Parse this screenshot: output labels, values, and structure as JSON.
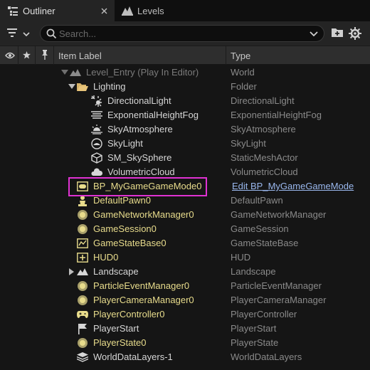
{
  "tabs": [
    {
      "label": "Outliner",
      "icon": "outliner-icon",
      "active": true
    },
    {
      "label": "Levels",
      "icon": "levels-icon",
      "active": false
    }
  ],
  "search": {
    "placeholder": "Search..."
  },
  "columns": {
    "item_label": "Item Label",
    "type": "Type"
  },
  "rows": [
    {
      "label": "Level_Entry (Play In Editor)",
      "type": "World",
      "icon": "world-icon",
      "style": "dim",
      "indent": 0,
      "expander": "expanded-dim"
    },
    {
      "label": "Lighting",
      "type": "Folder",
      "icon": "folder-open-icon",
      "style": "white",
      "indent": 1,
      "expander": "expanded"
    },
    {
      "label": "DirectionalLight",
      "type": "DirectionalLight",
      "icon": "directional-light-icon",
      "style": "white",
      "indent": 2
    },
    {
      "label": "ExponentialHeightFog",
      "type": "ExponentialHeightFog",
      "icon": "height-fog-icon",
      "style": "white",
      "indent": 2
    },
    {
      "label": "SkyAtmosphere",
      "type": "SkyAtmosphere",
      "icon": "sky-atmosphere-icon",
      "style": "white",
      "indent": 2
    },
    {
      "label": "SkyLight",
      "type": "SkyLight",
      "icon": "sky-light-icon",
      "style": "white",
      "indent": 2
    },
    {
      "label": "SM_SkySphere",
      "type": "StaticMeshActor",
      "icon": "static-mesh-icon",
      "style": "white",
      "indent": 2
    },
    {
      "label": "VolumetricCloud",
      "type": "VolumetricCloud",
      "icon": "volumetric-cloud-icon",
      "style": "white",
      "indent": 2
    },
    {
      "label": "BP_MyGameGameMode0",
      "type": "Edit BP_MyGameGameMode",
      "icon": "game-mode-icon",
      "style": "yellow",
      "indent": 1,
      "type_link": true
    },
    {
      "label": "DefaultPawn0",
      "type": "DefaultPawn",
      "icon": "pawn-icon",
      "style": "yellow",
      "indent": 1
    },
    {
      "label": "GameNetworkManager0",
      "type": "GameNetworkManager",
      "icon": "network-manager-icon",
      "style": "yellow",
      "indent": 1
    },
    {
      "label": "GameSession0",
      "type": "GameSession",
      "icon": "game-session-icon",
      "style": "yellow",
      "indent": 1
    },
    {
      "label": "GameStateBase0",
      "type": "GameStateBase",
      "icon": "game-state-icon",
      "style": "yellow",
      "indent": 1
    },
    {
      "label": "HUD0",
      "type": "HUD",
      "icon": "hud-icon",
      "style": "yellow",
      "indent": 1
    },
    {
      "label": "Landscape",
      "type": "Landscape",
      "icon": "landscape-icon",
      "style": "white",
      "indent": 1,
      "expander": "collapsed"
    },
    {
      "label": "ParticleEventManager0",
      "type": "ParticleEventManager",
      "icon": "particle-manager-icon",
      "style": "yellow",
      "indent": 1
    },
    {
      "label": "PlayerCameraManager0",
      "type": "PlayerCameraManager",
      "icon": "camera-manager-icon",
      "style": "yellow",
      "indent": 1
    },
    {
      "label": "PlayerController0",
      "type": "PlayerController",
      "icon": "controller-icon",
      "style": "yellow",
      "indent": 1
    },
    {
      "label": "PlayerStart",
      "type": "PlayerStart",
      "icon": "player-start-icon",
      "style": "white",
      "indent": 1
    },
    {
      "label": "PlayerState0",
      "type": "PlayerState",
      "icon": "player-state-icon",
      "style": "yellow",
      "indent": 1
    },
    {
      "label": "WorldDataLayers-1",
      "type": "WorldDataLayers",
      "icon": "data-layers-icon",
      "style": "white",
      "indent": 1
    }
  ],
  "colors": {
    "highlight": "#e032d2",
    "yellow_label": "#e8dc8c",
    "link": "#9ab8ee"
  }
}
